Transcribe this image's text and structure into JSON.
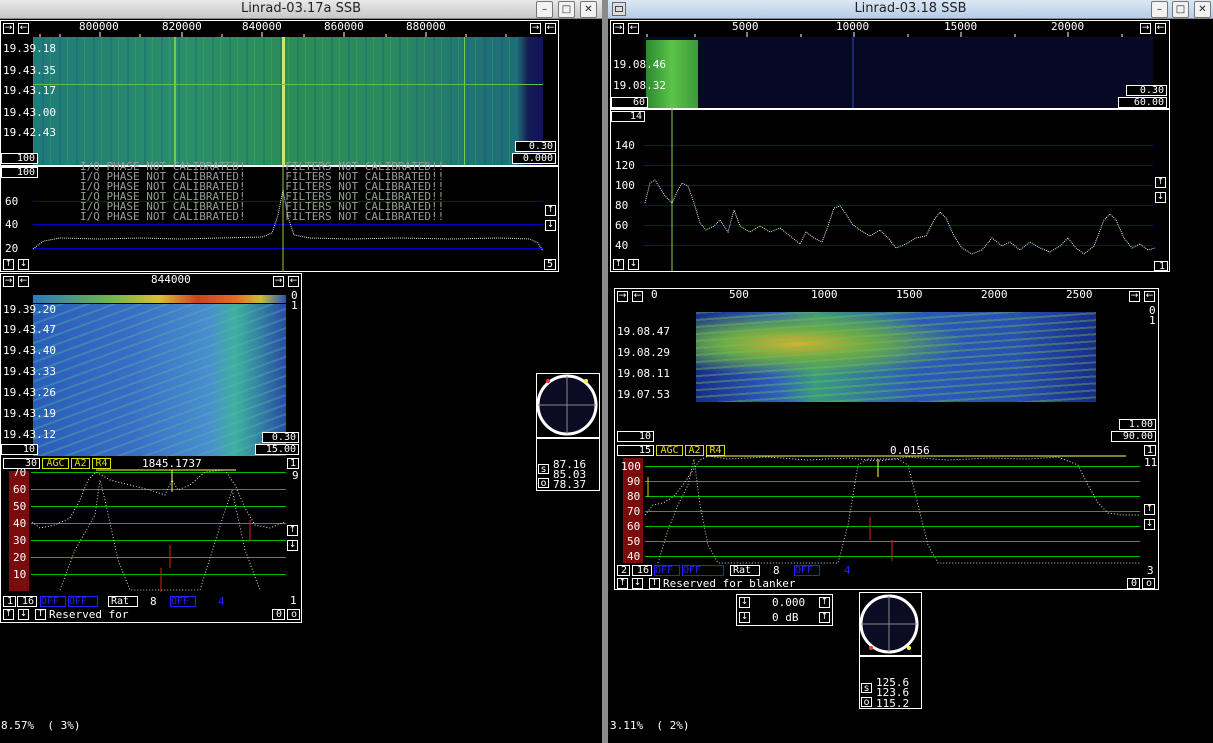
{
  "left_window": {
    "title": "Linrad-03.17a SSB",
    "freq_ticks": [
      "800000",
      "820000",
      "840000",
      "860000",
      "880000"
    ],
    "wf_times": [
      "19.39.18",
      "19.43.35",
      "19.43.17",
      "19.43.00",
      "19.42.43"
    ],
    "wf_gain": "0.30",
    "wf_offset": "0.000",
    "wf_avg": "100",
    "spec_avg": "100",
    "spec_y": [
      "60",
      "40",
      "20"
    ],
    "spec_zoom": "5",
    "calib_lines": [
      "I/Q PHASE NOT CALIBRATED!      FILTERS NOT CALIBRATED!!",
      "I/Q PHASE NOT CALIBRATED!      FILTERS NOT CALIBRATED!!",
      "I/Q PHASE NOT CALIBRATED!      FILTERS NOT CALIBRATED!!",
      "I/Q PHASE NOT CALIBRATED!      FILTERS NOT CALIBRATED!!",
      "I/Q PHASE NOT CALIBRATED!      FILTERS NOT CALIBRATED!!",
      "I/Q PHASE NOT CALIBRATED!      FILTERS NOT CALIBRATED!!"
    ],
    "bw_freq": "844000",
    "bw_right_top": "0",
    "bw_right_2": "1",
    "bw_times": [
      "19.39.20",
      "19.43.47",
      "19.43.40",
      "19.43.33",
      "19.43.26",
      "19.43.19",
      "19.43.12"
    ],
    "bw_gain": "0.30",
    "bw_offset": "15.00",
    "bw_avg": "10",
    "bfo_avg": "30",
    "agc": "AGC",
    "a2": "A2",
    "r4": "R4",
    "bfo_freq": "1845.1737",
    "bfo_right": "1",
    "bfo_right2": "9",
    "bfo_y": [
      "70",
      "60",
      "50",
      "40",
      "30",
      "20",
      "10"
    ],
    "bot_num1": "1",
    "bot_num2": "16",
    "off1": "OFF",
    "off2": "OFF",
    "rat_label": "Rat",
    "rat_val": "8",
    "off3": "OFF",
    "off3_val": "4",
    "bot_right": "1",
    "reserved": "Reserved for",
    "zero": "0",
    "o": "o",
    "status": "8.57%  ( 3%)",
    "meter_s": "87.16",
    "meter_2": "85.03",
    "meter_o": "78.37",
    "s_lbl": "s",
    "o_lbl": "o"
  },
  "right_window": {
    "title": "Linrad-03.18 SSB",
    "freq_ticks": [
      "5000",
      "10000",
      "15000",
      "20000"
    ],
    "wf_times": [
      "19.08.46",
      "19.08.32"
    ],
    "wf_gain": "0.30",
    "wf_offset": "60.00",
    "wf_avg": "60",
    "spec_avg": "14",
    "spec_y": [
      "140",
      "120",
      "100",
      "80",
      "60",
      "40"
    ],
    "spec_zoom": "1",
    "bw_ticks": [
      "0",
      "500",
      "1000",
      "1500",
      "2000",
      "2500"
    ],
    "bw_right_top": "0",
    "bw_right_2": "1",
    "bw_times": [
      "19.08.47",
      "19.08.29",
      "19.08.11",
      "19.07.53"
    ],
    "bw_gain": "1.00",
    "bw_offset": "90.00",
    "bw_avg": "10",
    "bfo_avg": "15",
    "agc": "AGC",
    "a2": "A2",
    "r4": "R4",
    "bfo_freq": "0.0156",
    "bfo_right": "1",
    "bfo_right2": "11",
    "bfo_y": [
      "100",
      "90",
      "80",
      "70",
      "60",
      "50",
      "40"
    ],
    "bot_num1": "2",
    "bot_num2": "16",
    "off1": "OFF",
    "off2": "OFF",
    "rat_label": "Rat",
    "rat_val": "8",
    "off3": "OFF",
    "off3_val": "4",
    "bot_right": "3",
    "reserved": "Reserved for blanker",
    "zero": "0",
    "o": "o",
    "gain_val": "0.000",
    "gain_db": "0 dB",
    "status": "3.11%  ( 2%)",
    "meter_s": "125.6",
    "meter_2": "123.6",
    "meter_o": "115.2",
    "s_lbl": "s",
    "o_lbl": "o"
  }
}
